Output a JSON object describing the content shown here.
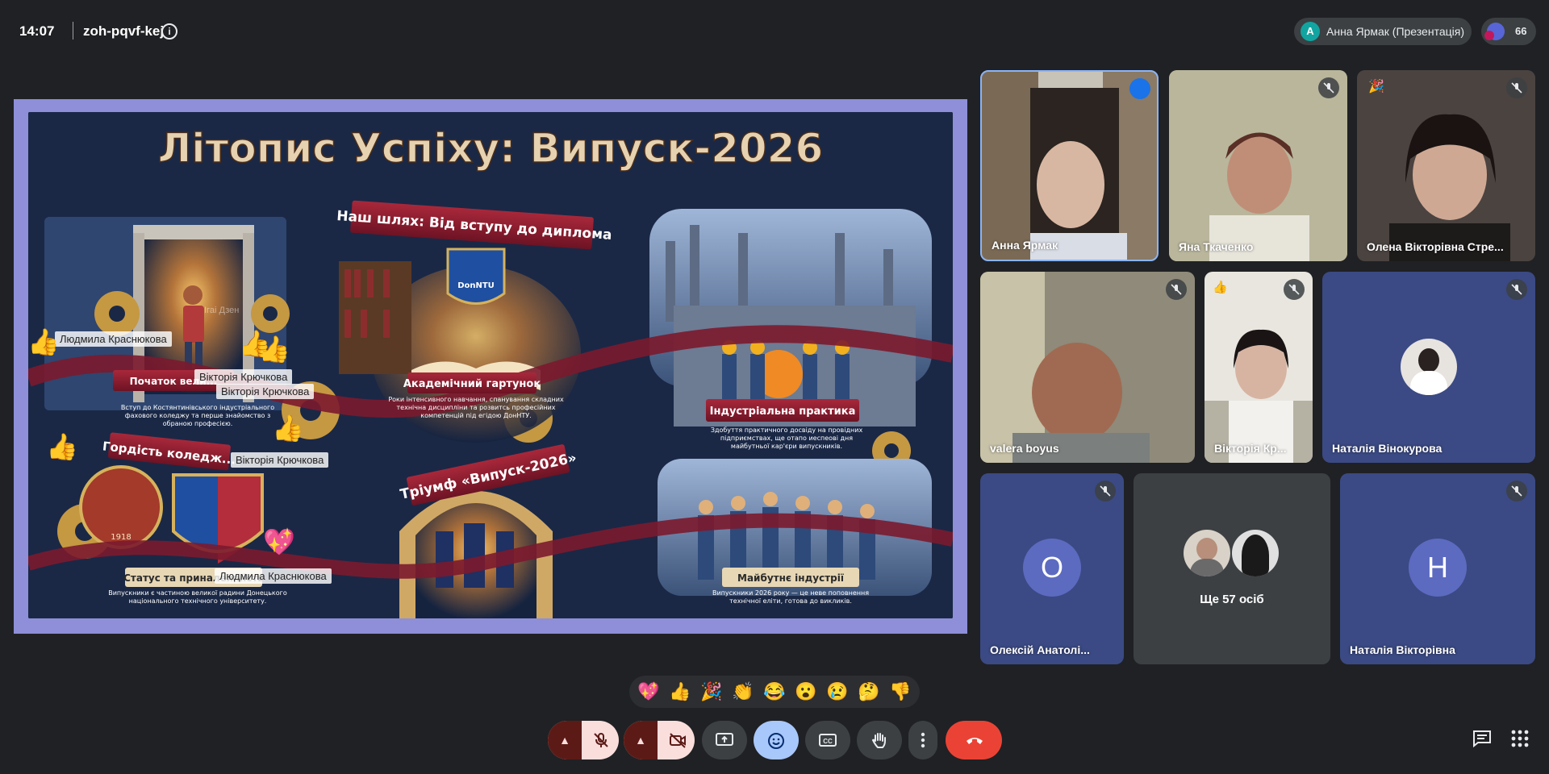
{
  "meeting": {
    "time": "14:07",
    "code": "zoh-pqvf-kej",
    "presenter": "Анна Ярмак (Презентація)",
    "presenter_initial": "А",
    "participant_count": "66"
  },
  "slide": {
    "title": "Літопис Успіху: Випуск-2026",
    "banner_path": "Наш шлях: Від вступу до диплома",
    "shield_label": "DonNTU",
    "sections": [
      {
        "title": "Початок вели...",
        "text": "Вступ до Костянтинівського індустріального фахового коледжу та перше знайомство з обраною професією."
      },
      {
        "title": "Академічний гартунок",
        "text": "Роки інтенсивного навчання, спанування складних технічна дисципліни та розвитсь професійних компетенцій під егідою ДонНТУ."
      },
      {
        "title": "Індустріальна практика",
        "text": "Здобуття практичного досвіду на провідних підприємствах, ще отапо иеспеові дня майбутньої кар'єри випускників."
      },
      {
        "title": "Гордість коледж...",
        "text": ""
      },
      {
        "title": "Тріумф «Випуск-2026»",
        "text": ""
      },
      {
        "title": "Статус та приналежність",
        "text": "Випускники є частиною великої радини Донецького національного технічного університету."
      },
      {
        "title": "Майбутнє індустрії",
        "text": "Випускники 2026 року — це неве поповнення технічної еліти, готова до викликів."
      }
    ],
    "seal_text": "1918",
    "overlay_names": [
      "Людмила Краснюкова",
      "Вікторія Крючкова",
      "Вікторія Крючкова",
      "Вікторія Крючкова",
      "Людмила Краснюкова"
    ],
    "faint_name": "Ігаі Дзен"
  },
  "tiles": [
    {
      "name": "Анна Ярмак",
      "muted": false
    },
    {
      "name": "Яна Ткаченко",
      "muted": true
    },
    {
      "name": "Олена Вікторівна Стре...",
      "muted": true
    },
    {
      "name": "valera boyus",
      "muted": true
    },
    {
      "name": "Вікторія Кр...",
      "muted": true
    },
    {
      "name": "Наталія Вінокурова",
      "muted": true
    },
    {
      "name": "Олексій Анатолі...",
      "muted": true,
      "initial": "О"
    },
    {
      "name": "Ще 57 осіб",
      "muted": false
    },
    {
      "name": "Наталія Вікторівна",
      "muted": true,
      "initial": "Н"
    }
  ],
  "reactions": [
    "💖",
    "👍",
    "🎉",
    "👏",
    "😂",
    "😮",
    "😢",
    "🤔",
    "👎"
  ],
  "colors": {
    "background": "#202124",
    "end_call": "#ea4335",
    "accent": "#8ab4f8",
    "tile_navy": "#3b4a84"
  },
  "icons": [
    "info-icon",
    "mic-off-icon",
    "camera-off-icon",
    "present-icon",
    "emoji-icon",
    "captions-icon",
    "raise-hand-icon",
    "more-icon",
    "end-call-icon",
    "chat-icon",
    "apps-icon"
  ]
}
